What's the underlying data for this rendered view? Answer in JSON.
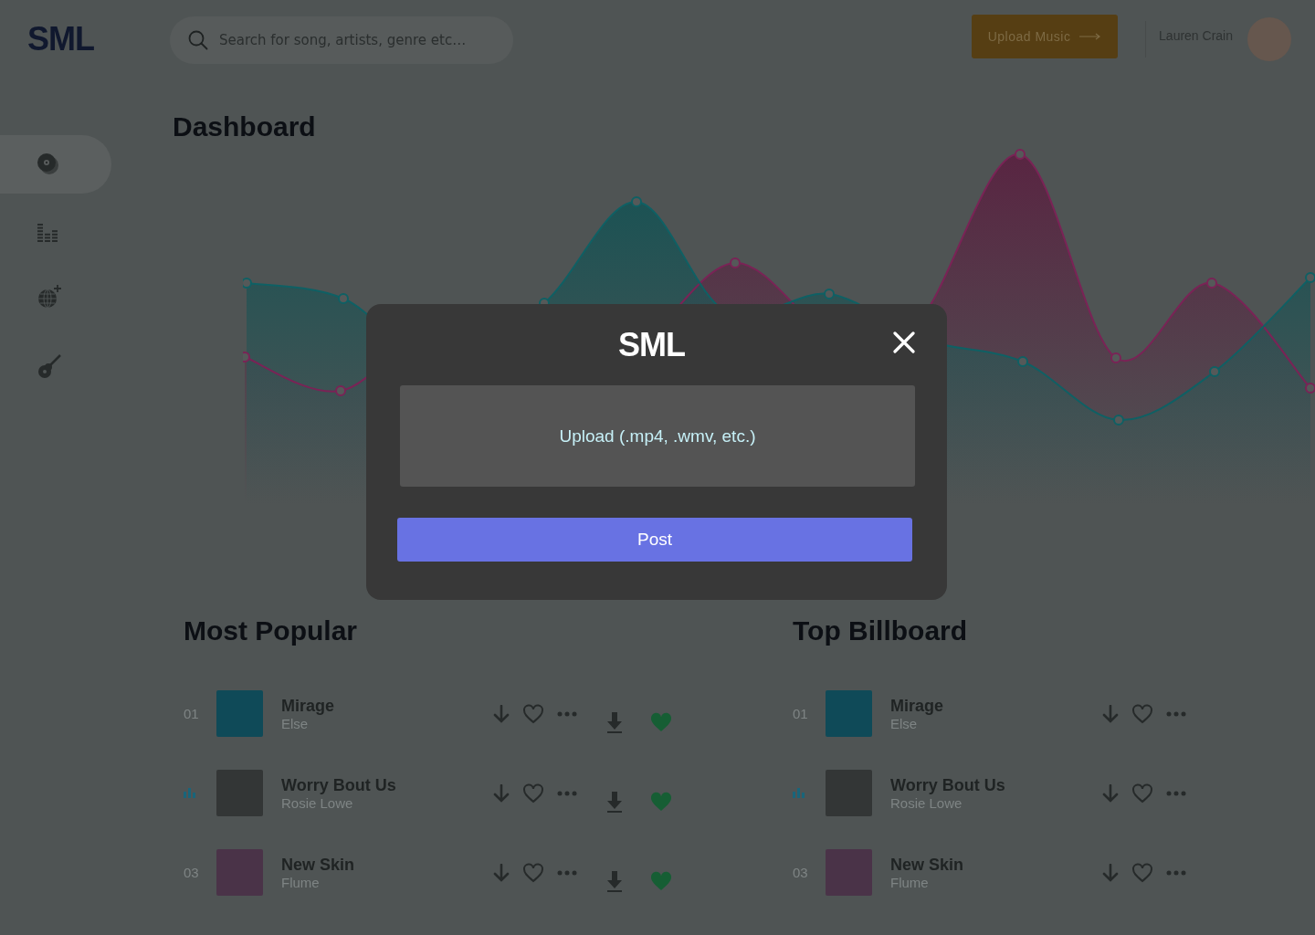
{
  "header": {
    "logo": "SML",
    "search": {
      "placeholder": "Search for song, artists, genre etc…"
    },
    "upload_button": "Upload Music",
    "user_name": "Lauren Crain"
  },
  "sidebar": {
    "items": [
      {
        "kind": "disc",
        "selected": true
      },
      {
        "kind": "equalizer",
        "selected": false
      },
      {
        "kind": "disco",
        "selected": false
      },
      {
        "kind": "guitar",
        "selected": false
      }
    ]
  },
  "page_title": "Dashboard",
  "lists": [
    {
      "title": "Most Popular",
      "rows": [
        {
          "rank": "01",
          "playing": false,
          "title": "Mirage",
          "artist": "Else",
          "liked": true
        },
        {
          "playing": true,
          "title": "Worry Bout Us",
          "artist": "Rosie Lowe",
          "liked": true
        },
        {
          "rank": "03",
          "playing": false,
          "title": "New Skin",
          "artist": "Flume",
          "liked": true
        }
      ]
    },
    {
      "title": "Top Billboard",
      "rows": [
        {
          "rank": "01",
          "playing": false,
          "title": "Mirage",
          "artist": "Else",
          "liked": false
        },
        {
          "playing": true,
          "title": "Worry Bout Us",
          "artist": "Rosie Lowe",
          "liked": false
        },
        {
          "rank": "03",
          "playing": false,
          "title": "New Skin",
          "artist": "Flume",
          "liked": false
        }
      ]
    }
  ],
  "modal": {
    "logo": "SML",
    "upload_area": "Upload (.mp4, .wmv, etc.)",
    "post_button": "Post"
  }
}
